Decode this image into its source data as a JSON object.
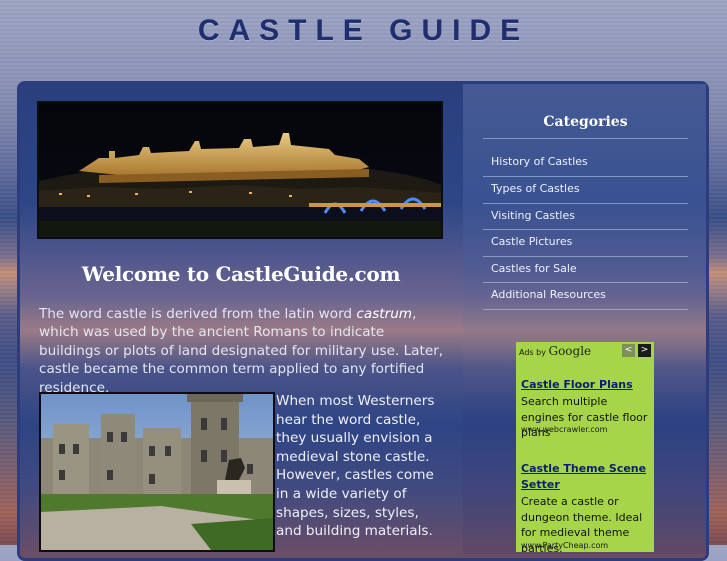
{
  "header": {
    "site_title": "CASTLE GUIDE"
  },
  "main": {
    "welcome_heading": "Welcome to CastleGuide.com",
    "intro_before": "The word castle is derived from the latin word ",
    "intro_emph": "castrum",
    "intro_after": ", which was used by the ancient Romans to indicate buildings or plots of land designated for military use. Later, castle became the common term applied to any fortified residence.",
    "body_text": "When most Westerners hear the word castle, they usually envision a medieval stone castle. However, castles come in a wide variety of shapes, sizes, styles, and building materials."
  },
  "sidebar": {
    "categories_title": "Categories",
    "items": [
      {
        "label": "History of Castles"
      },
      {
        "label": "Types of Castles"
      },
      {
        "label": "Visiting Castles"
      },
      {
        "label": "Castle Pictures"
      },
      {
        "label": "Castles for Sale"
      },
      {
        "label": "Additional Resources"
      }
    ]
  },
  "ads": {
    "ads_by": "Ads by",
    "google": "Google",
    "prev": "<",
    "next": ">",
    "items": [
      {
        "title": "Castle Floor Plans",
        "desc": "Search multiple engines for castle floor plans",
        "url": "www.webcrawler.com"
      },
      {
        "title": "Castle Theme Scene Setter",
        "desc": "Create a castle or dungeon theme. Ideal for medieval theme parties.",
        "url": "www.PartyCheap.com"
      }
    ]
  },
  "colors": {
    "title": "#1f2e6e",
    "ads_bg": "#a7d54a",
    "ad_link": "#0a1e6e"
  }
}
